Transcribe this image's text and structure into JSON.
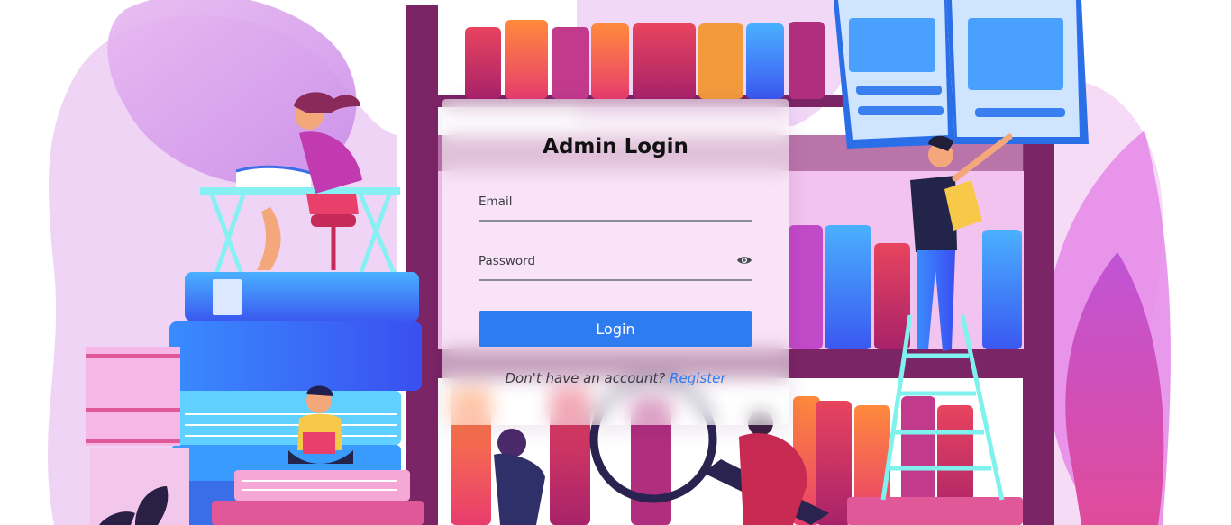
{
  "login": {
    "title": "Admin Login",
    "email_label": "Email",
    "password_label": "Password",
    "submit_label": "Login",
    "footer_prompt": "Don't have an account?",
    "register_link": "Register"
  },
  "icons": {
    "password_toggle": "eye-icon"
  },
  "colors": {
    "primary": "#2f7bf0",
    "shelf": "#7b2466",
    "background_accent": "#c98be8"
  }
}
